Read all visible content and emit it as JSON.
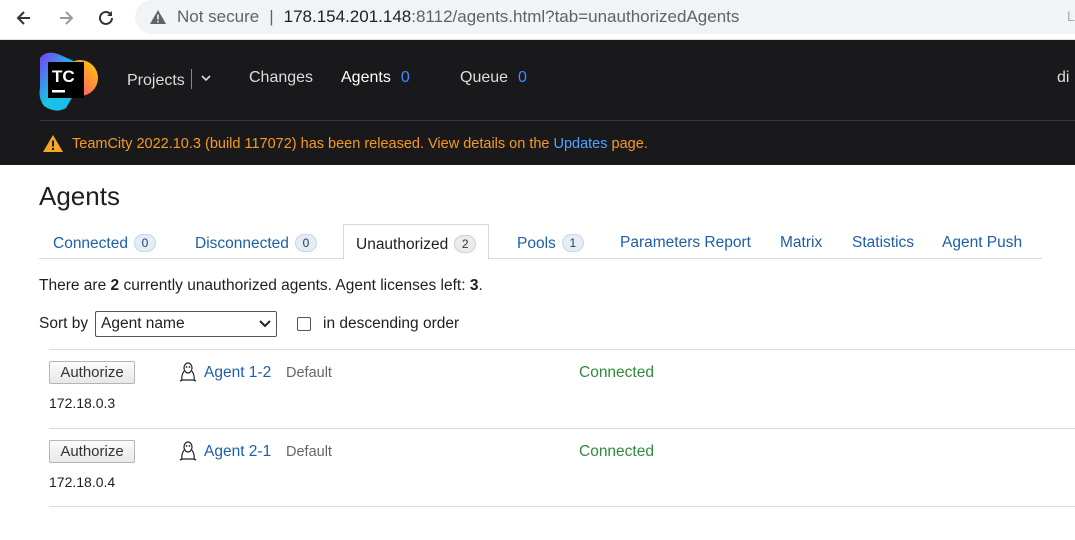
{
  "browser": {
    "security": "Not secure",
    "url_host": "178.154.201.148",
    "url_rest": ":8112/agents.html?tab=unauthorizedAgents",
    "corner": "L"
  },
  "header": {
    "logo_text": "TC",
    "nav": [
      {
        "label": "Projects"
      },
      {
        "label": "Changes"
      },
      {
        "label": "Agents",
        "count": "0"
      },
      {
        "label": "Queue",
        "count": "0"
      }
    ],
    "user_cut": "di",
    "notice": {
      "before": "TeamCity 2022.10.3 (build 117072) has been released. View details on the",
      "link": "Updates",
      "after": "page."
    }
  },
  "page": {
    "title": "Agents",
    "tabs": [
      {
        "label": "Connected",
        "count": "0"
      },
      {
        "label": "Disconnected",
        "count": "0"
      },
      {
        "label": "Unauthorized",
        "count": "2"
      },
      {
        "label": "Pools",
        "count": "1"
      },
      {
        "label": "Parameters Report"
      },
      {
        "label": "Matrix"
      },
      {
        "label": "Statistics"
      },
      {
        "label": "Agent Push"
      }
    ],
    "summary": {
      "p1": "There are",
      "count": "2",
      "p2": "currently unauthorized agents. Agent licenses left:",
      "licenses": "3",
      "p3": "."
    },
    "sort": {
      "label": "Sort by",
      "selected": "Agent name",
      "desc_label": "in descending order",
      "desc_checked": false
    }
  },
  "agents": [
    {
      "button": "Authorize",
      "name": "Agent 1-2",
      "pool": "Default",
      "status": "Connected",
      "ip": "172.18.0.3"
    },
    {
      "button": "Authorize",
      "name": "Agent 2-1",
      "pool": "Default",
      "status": "Connected",
      "ip": "172.18.0.4"
    }
  ],
  "colors": {
    "header_bg": "#19191c",
    "link": "#1d5fa8",
    "status_connected": "#2f8a3a",
    "notice": "#f59a23",
    "count_accent": "#3a8cff"
  }
}
